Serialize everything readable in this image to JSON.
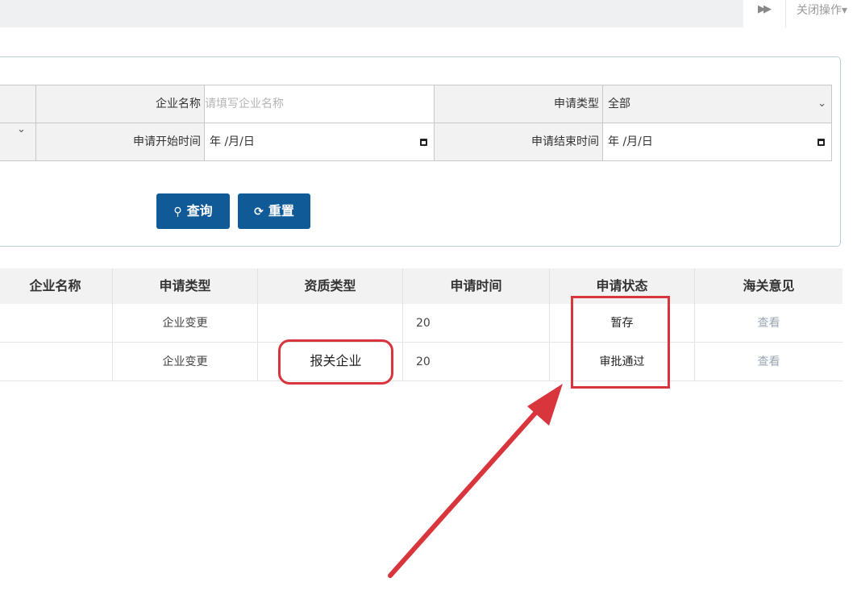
{
  "tab_bar": {
    "forward_icon": "double-chevron-right-icon",
    "close_ops_label": "关闭操作"
  },
  "search_form": {
    "company_name": {
      "label": "企业名称",
      "placeholder": "请填写企业名称"
    },
    "apply_type": {
      "label": "申请类型",
      "selected": "全部"
    },
    "start_time": {
      "label": "申请开始时间",
      "value": "年 /月/日"
    },
    "end_time": {
      "label": "申请结束时间",
      "value": "年 /月/日"
    },
    "query_button": "查询",
    "reset_button": "重置"
  },
  "results_table": {
    "columns": [
      "企业名称",
      "申请类型",
      "资质类型",
      "申请时间",
      "申请状态",
      "海关意见"
    ],
    "rows": [
      {
        "company": "",
        "apply_type": "企业变更",
        "qualification": "",
        "time": "20",
        "status": "暂存",
        "opinion": "查看"
      },
      {
        "company": "",
        "apply_type": "企业变更",
        "qualification": "报关企业",
        "time": "20",
        "status": "审批通过",
        "opinion": "查看"
      }
    ]
  },
  "colors": {
    "primary_button": "#0f5a97",
    "annotation_red": "#d8353d",
    "panel_border": "#b9d0da"
  }
}
